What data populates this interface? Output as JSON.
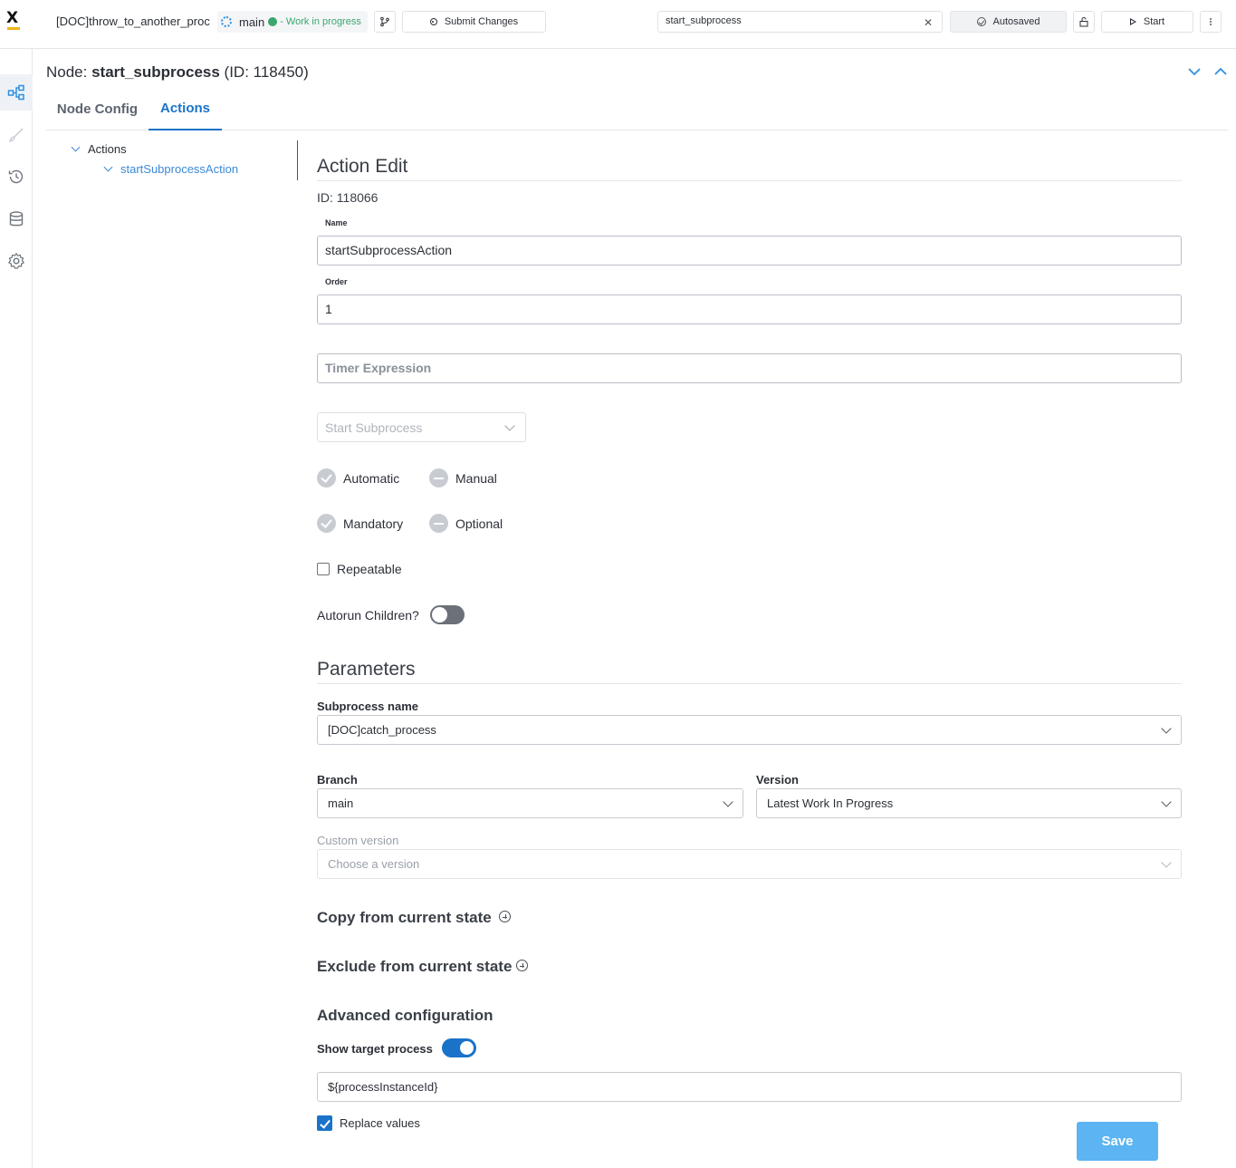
{
  "header": {
    "process_title": "[DOC]throw_to_another_proc",
    "branch": "main",
    "branch_status": "- Work in progress",
    "submit_label": "Submit Changes",
    "search_value": "start_subprocess",
    "autosave_label": "Autosaved",
    "start_label": "Start"
  },
  "node": {
    "prefix": "Node: ",
    "name": "start_subprocess",
    "id_text": " (ID: 118450)"
  },
  "tabs": [
    {
      "label": "Node Config",
      "active": false
    },
    {
      "label": "Actions",
      "active": true
    }
  ],
  "tree": {
    "root": "Actions",
    "child": "startSubprocessAction"
  },
  "action_edit": {
    "title": "Action Edit",
    "id_text": "ID: 118066",
    "name_label": "Name",
    "name_value": "startSubprocessAction",
    "order_label": "Order",
    "order_value": "1",
    "timer_placeholder": "Timer Expression",
    "action_type": "Start Subprocess",
    "automatic_label": "Automatic",
    "manual_label": "Manual",
    "mandatory_label": "Mandatory",
    "optional_label": "Optional",
    "repeatable_label": "Repeatable",
    "autorun_label": "Autorun Children?"
  },
  "parameters": {
    "title": "Parameters",
    "subprocess_label": "Subprocess name",
    "subprocess_value": "[DOC]catch_process",
    "branch_label": "Branch",
    "branch_value": "main",
    "version_label": "Version",
    "version_value": "Latest Work In Progress",
    "custom_version_label": "Custom version",
    "custom_version_placeholder": "Choose a version",
    "copy_label": "Copy from current state",
    "exclude_label": "Exclude from current state",
    "advanced_label": "Advanced configuration",
    "show_target_label": "Show target process",
    "target_value": "${processInstanceId}",
    "replace_label": "Replace values",
    "save_label": "Save"
  },
  "colors": {
    "accent": "#1a73c8",
    "save_button": "#5cb4f2",
    "success": "#3aa76d",
    "logo_bar": "#f1b31c"
  },
  "icons": [
    "logo-icon",
    "branch-icon",
    "lock-icon",
    "more-icon",
    "process-icon",
    "brush-icon",
    "history-icon",
    "database-icon",
    "settings-icon"
  ]
}
